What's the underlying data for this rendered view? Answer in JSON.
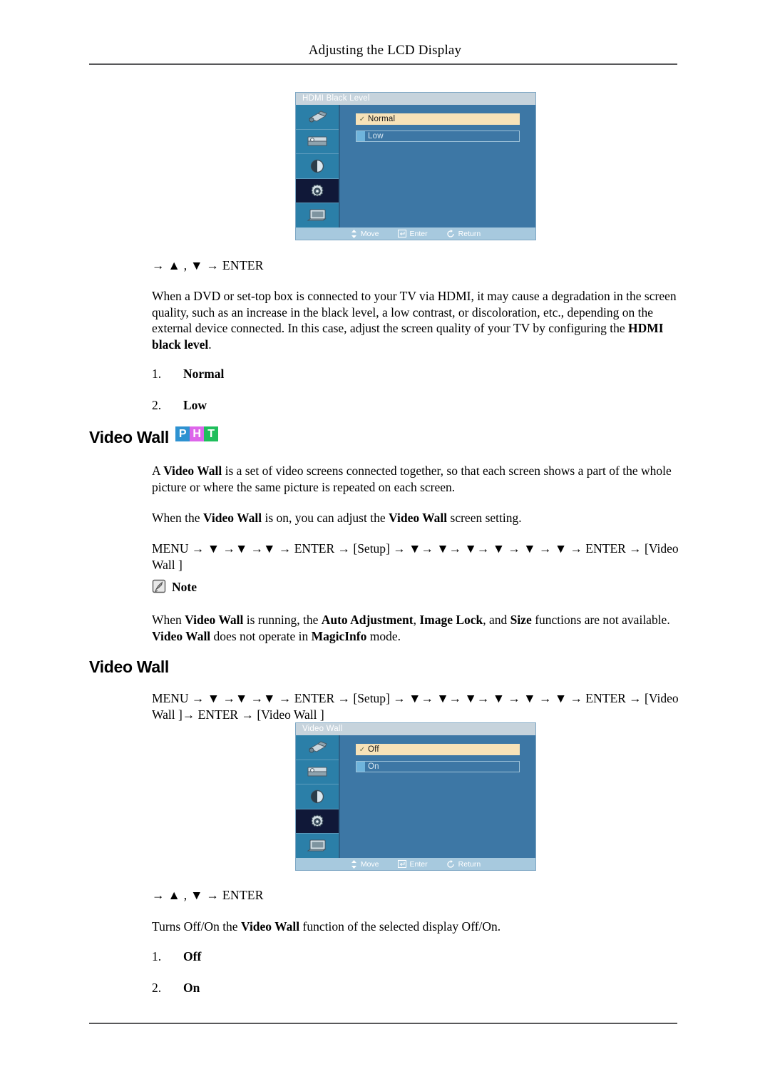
{
  "page": {
    "running_header": "Adjusting the LCD Display"
  },
  "osd_hdmi": {
    "title": "HDMI Black Level",
    "options": [
      {
        "label": "Normal",
        "selected": true
      },
      {
        "label": "Low",
        "selected": false
      }
    ],
    "footer": [
      {
        "icon": "move-arrows-icon",
        "label": "Move"
      },
      {
        "icon": "enter-key-icon",
        "label": "Enter"
      },
      {
        "icon": "return-arrow-icon",
        "label": "Return"
      }
    ],
    "tabs": [
      {
        "icon": "input-source-icon",
        "selected": false
      },
      {
        "icon": "picture-card-icon",
        "selected": false
      },
      {
        "icon": "contrast-circle-icon",
        "selected": false
      },
      {
        "icon": "setup-gear-icon",
        "selected": true
      },
      {
        "icon": "display-monitor-icon",
        "selected": false
      }
    ],
    "colors": {
      "panel": "#3d77a5",
      "title_bar": "#c6d3dc",
      "tab": "#2b7fa8",
      "tab_selected": "#101838",
      "highlight": "#f7e2b8",
      "footer_bar": "#a7c9de"
    }
  },
  "hdmi_section": {
    "key_sequence": "→ ▲ , ▼ → ENTER",
    "description_part1": "When a DVD or set-top box is connected to your TV via HDMI, it may cause a degradation in the screen quality, such as an increase in the black level, a low contrast, or discoloration, etc., depending on the external device connected. In this case, adjust the screen quality of your TV by configuring the ",
    "description_bold": "HDMI black level",
    "description_end": ".",
    "items": [
      {
        "num": "1.",
        "label": "Normal"
      },
      {
        "num": "2.",
        "label": "Low"
      }
    ]
  },
  "video_wall_section": {
    "heading": "Video Wall",
    "badges": [
      {
        "letter": "P",
        "color": "#2e92d1"
      },
      {
        "letter": "H",
        "color": "#dd66ea"
      },
      {
        "letter": "T",
        "color": "#1fbe5c"
      }
    ],
    "intro_a": "A ",
    "intro_bold": "Video Wall",
    "intro_b": " is a set of video screens connected together, so that each screen shows a part of the whole picture or where the same picture is repeated on each screen.",
    "on_a": "When the ",
    "on_bold1": "Video Wall",
    "on_b": " is on, you can adjust the ",
    "on_bold2": "Video Wall",
    "on_c": " screen setting.",
    "menu_path": "MENU → ▼ →▼ →▼ → ENTER → [Setup] → ▼→ ▼→ ▼→ ▼ → ▼ → ▼ → ENTER → [Video Wall ]",
    "note_label": "Note",
    "note_a": "When ",
    "note_bold1": "Video Wall",
    "note_b": " is running, the ",
    "note_bold2": "Auto Adjustment",
    "note_c": ", ",
    "note_bold3": "Image Lock",
    "note_d": ", and ",
    "note_bold4": "Size",
    "note_e": " functions are not available. ",
    "note_bold5": "Video Wall",
    "note_f": " does not operate in ",
    "note_bold6": "MagicInfo",
    "note_g": " mode."
  },
  "video_wall_sub": {
    "heading": "Video Wall",
    "menu_path": "MENU → ▼ →▼ →▼ → ENTER → [Setup] → ▼→ ▼→ ▼→ ▼ → ▼ → ▼ → ENTER → [Video Wall ]→ ENTER → [Video Wall ]",
    "key_sequence": "→ ▲ , ▼ → ENTER",
    "description_a": "Turns Off/On the ",
    "description_bold": "Video Wall",
    "description_b": " function of the selected display Off/On.",
    "items": [
      {
        "num": "1.",
        "label": "Off"
      },
      {
        "num": "2.",
        "label": "On"
      }
    ]
  },
  "osd_videowall": {
    "title": "Video Wall",
    "options": [
      {
        "label": "Off",
        "selected": true
      },
      {
        "label": "On",
        "selected": false
      }
    ],
    "footer": [
      {
        "icon": "move-arrows-icon",
        "label": "Move"
      },
      {
        "icon": "enter-key-icon",
        "label": "Enter"
      },
      {
        "icon": "return-arrow-icon",
        "label": "Return"
      }
    ]
  }
}
